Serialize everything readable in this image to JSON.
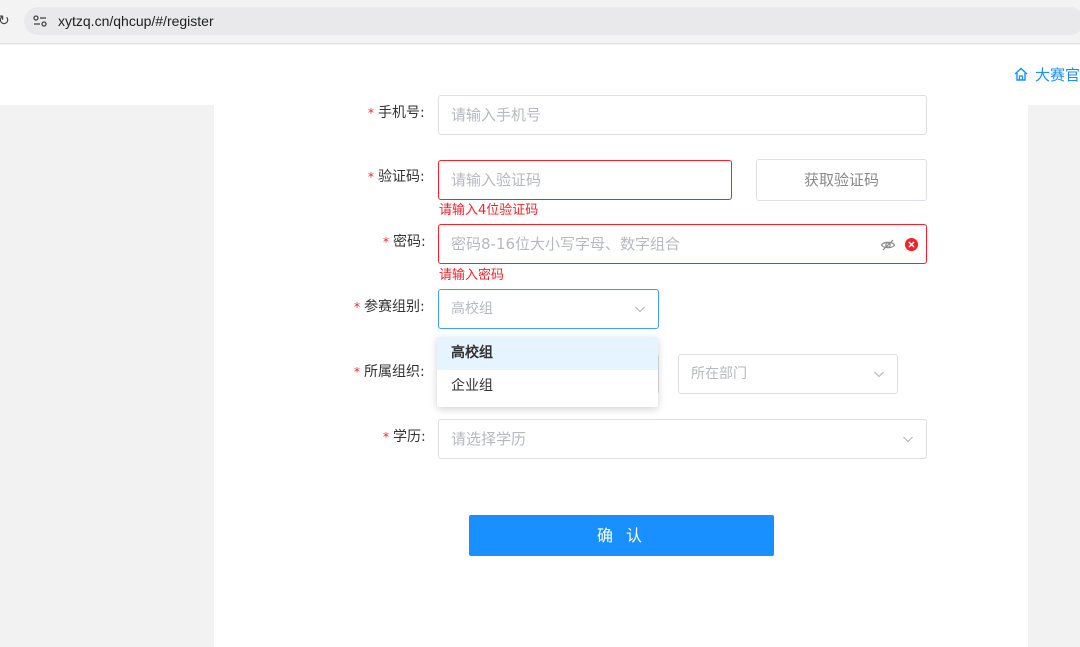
{
  "browser": {
    "url": "xytzq.cn/qhcup/#/register"
  },
  "header": {
    "home_link": "大赛官"
  },
  "form": {
    "phone": {
      "label": "手机号:",
      "placeholder": "请输入手机号"
    },
    "code": {
      "label": "验证码:",
      "placeholder": "请输入验证码",
      "error": "请输入4位验证码",
      "get_code_button": "获取验证码"
    },
    "password": {
      "label": "密码:",
      "placeholder": "密码8-16位大小写字母、数字组合",
      "error": "请输入密码"
    },
    "group": {
      "label": "参赛组别:",
      "selected": "高校组",
      "options": [
        "高校组",
        "企业组"
      ]
    },
    "organization": {
      "label": "所属组织:",
      "department_placeholder": "所在部门"
    },
    "education": {
      "label": "学历:",
      "placeholder": "请选择学历"
    },
    "required_mark": "*",
    "confirm_button": "确 认"
  },
  "colors": {
    "primary": "#1890ff",
    "error": "#f5222d",
    "focus": "#409eff"
  }
}
